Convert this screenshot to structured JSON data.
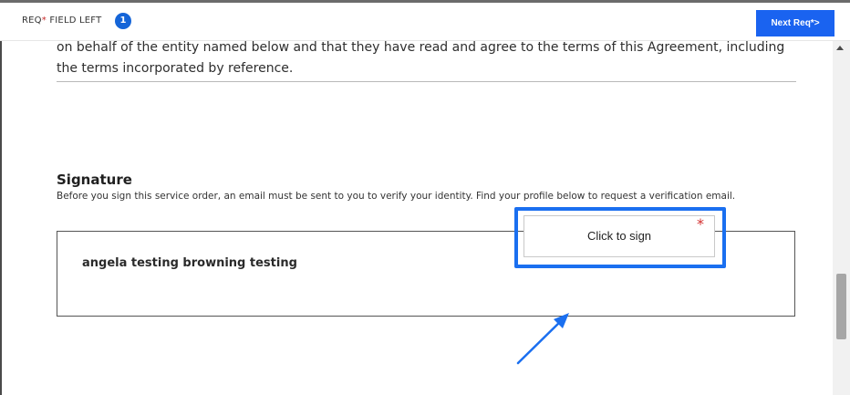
{
  "req_bar": {
    "label_prefix": "REQ",
    "label_star": "*",
    "label_suffix": " FIELD LEFT",
    "count": "1",
    "next_button": "Next Req*>"
  },
  "agreement": {
    "text": "on behalf of the entity named below and that they have read and agree to the terms of this Agreement, including the terms incorporated by reference."
  },
  "signature": {
    "title": "Signature",
    "description": "Before you sign this service order, an email must be sent to you to verify your identity. Find your profile below to request a verification email.",
    "signer_name": "angela testing browning testing",
    "sign_button": "Click to sign",
    "required_marker": "*"
  },
  "colors": {
    "accent": "#1a63f0",
    "required": "#d32f2f"
  }
}
